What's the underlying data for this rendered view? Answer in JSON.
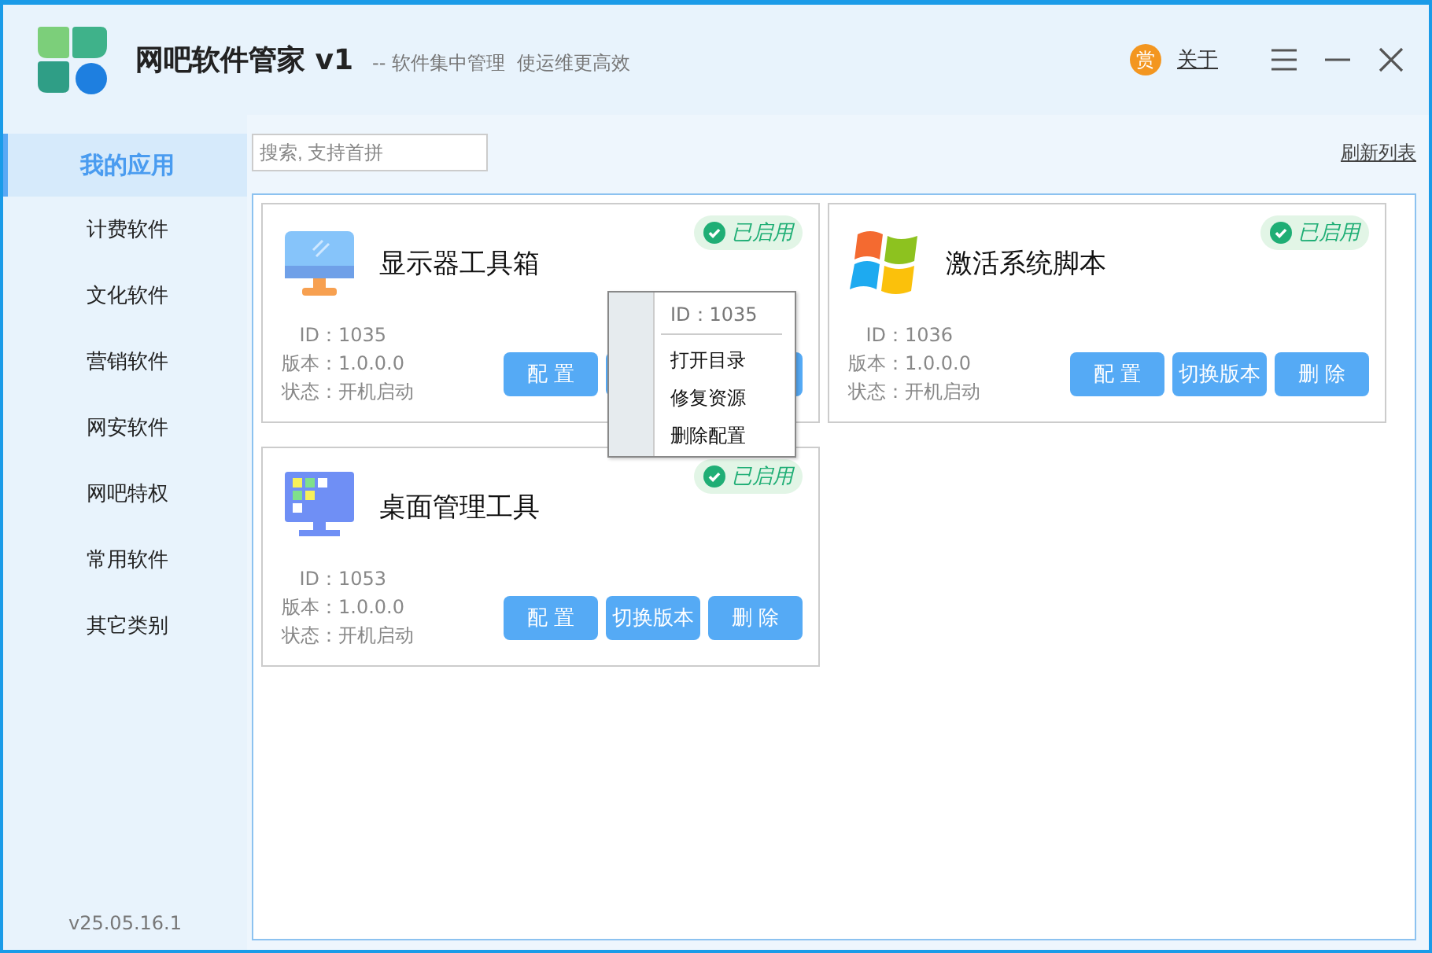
{
  "window": {
    "title": "网吧软件管家 v1",
    "subtitle": "-- 软件集中管理  使运维更高效",
    "reward": "赏",
    "about": "关于"
  },
  "sidebar": {
    "items": [
      {
        "label": "我的应用",
        "selected": true
      },
      {
        "label": "计费软件",
        "selected": false
      },
      {
        "label": "文化软件",
        "selected": false
      },
      {
        "label": "营销软件",
        "selected": false
      },
      {
        "label": "网安软件",
        "selected": false
      },
      {
        "label": "网吧特权",
        "selected": false
      },
      {
        "label": "常用软件",
        "selected": false
      },
      {
        "label": "其它类别",
        "selected": false
      }
    ],
    "version": "v25.05.16.1"
  },
  "search": {
    "placeholder": "搜索, 支持首拼"
  },
  "refresh": "刷新列表",
  "apps": [
    {
      "name": "显示器工具箱",
      "kind": "monitor",
      "enabled": true,
      "badge": "已启用",
      "info": [
        {
          "label": "ID：",
          "value": "1035"
        },
        {
          "label": "版本：",
          "value": "1.0.0.0"
        },
        {
          "label": "状态：",
          "value": "开机启动"
        }
      ],
      "buttons": [
        {
          "label": "配 置"
        },
        {
          "kind": "hidden"
        },
        {
          "kind": "hidden"
        }
      ]
    },
    {
      "name": "激活系统脚本",
      "kind": "windows",
      "enabled": true,
      "badge": "已启用",
      "info": [
        {
          "label": "ID：",
          "value": "1036"
        },
        {
          "label": "版本：",
          "value": "1.0.0.0"
        },
        {
          "label": "状态：",
          "value": "开机启动"
        }
      ],
      "buttons": [
        {
          "label": "配 置"
        },
        {
          "label": "切换版本"
        },
        {
          "label": "删 除"
        }
      ]
    },
    {
      "name": "桌面管理工具",
      "kind": "desktop",
      "enabled": true,
      "badge": "已启用",
      "info": [
        {
          "label": "ID：",
          "value": "1053"
        },
        {
          "label": "版本：",
          "value": "1.0.0.0"
        },
        {
          "label": "状态：",
          "value": "开机启动"
        }
      ],
      "buttons": [
        {
          "label": "配 置"
        },
        {
          "label": "切换版本"
        },
        {
          "label": "删 除"
        }
      ]
    }
  ],
  "context_menu": {
    "header": "ID：1035",
    "items": [
      "打开目录",
      "修复资源",
      "删除配置"
    ]
  }
}
